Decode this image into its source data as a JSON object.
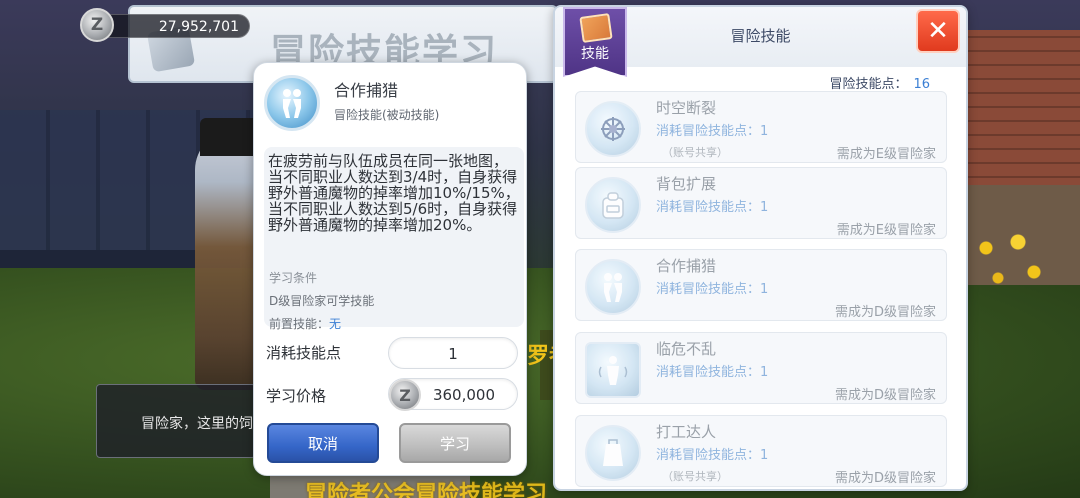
{
  "currency": {
    "icon": "zeny-coin-icon",
    "symbol": "Z",
    "amount": "27,952,701"
  },
  "window_title": "冒险技能学习",
  "detail": {
    "skill_name": "合作捕猎",
    "skill_type": "冒险技能(被动技能)",
    "description": "在疲劳前与队伍成员在同一张地图，当不同职业人数达到3/4时，自身获得野外普通魔物的掉率增加10%/15%，当不同职业人数达到5/6时，自身获得野外普通魔物的掉率增加20%。",
    "condition_title": "学习条件",
    "condition_text": "D级冒险家可学技能",
    "prereq_label": "前置技能：",
    "prereq_value": "无",
    "cost_label": "消耗技能点",
    "cost_value": "1",
    "price_label": "学习价格",
    "price_value": "360,000",
    "price_symbol": "Z",
    "cancel_label": "取消",
    "learn_label": "学习"
  },
  "panel": {
    "tab_label": "技能",
    "title": "冒险技能",
    "points_label": "冒险技能点：",
    "points_value": "16",
    "close_symbol": "✕",
    "skills": [
      {
        "name": "时空断裂",
        "cost": "消耗冒险技能点：1",
        "share": "（账号共享）",
        "requirement": "需成为E级冒险家",
        "icon": "time-rift-icon"
      },
      {
        "name": "背包扩展",
        "cost": "消耗冒险技能点：1",
        "share": "",
        "requirement": "需成为E级冒险家",
        "icon": "backpack-icon"
      },
      {
        "name": "合作捕猎",
        "cost": "消耗冒险技能点：1",
        "share": "",
        "requirement": "需成为D级冒险家",
        "icon": "cooperative-hunt-icon"
      },
      {
        "name": "临危不乱",
        "cost": "消耗冒险技能点：1",
        "share": "",
        "requirement": "需成为D级冒险家",
        "icon": "calm-under-pressure-icon"
      },
      {
        "name": "打工达人",
        "cost": "消耗冒险技能点：1",
        "share": "（账号共享）",
        "requirement": "需成为D级冒险家",
        "icon": "part-time-expert-icon"
      }
    ]
  },
  "chat": {
    "text": "冒险家，这里的饲"
  },
  "background_text": {
    "bottom": "冒险者公会冒险技能学习",
    "side": "罗者"
  }
}
